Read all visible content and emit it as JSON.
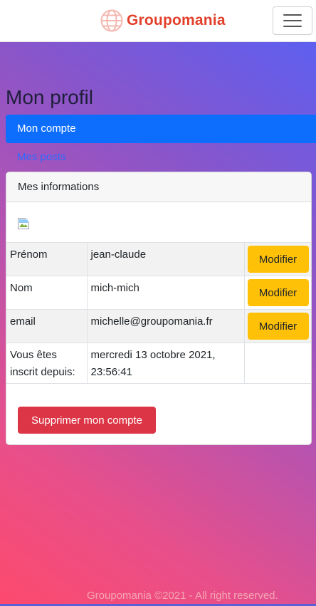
{
  "navbar": {
    "brand_name": "Groupomania",
    "brand_color": "#e2402b",
    "brand_icon": "globe-icon",
    "toggle_icon": "hamburger-icon"
  },
  "page": {
    "title": "Mon profil"
  },
  "tabs": {
    "active_label": "Mon compte",
    "posts_label": "Mes posts",
    "active_color": "#0d6efd"
  },
  "card": {
    "header": "Mes informations",
    "avatar_icon": "broken-image-icon",
    "rows": [
      {
        "label": "Prénom",
        "value": "jean-claude",
        "action": "Modifier"
      },
      {
        "label": "Nom",
        "value": "mich-mich",
        "action": "Modifier"
      },
      {
        "label": "email",
        "value": "michelle@groupomania.fr",
        "action": "Modifier"
      },
      {
        "label": "Vous êtes inscrit depuis:",
        "value": "mercredi 13 octobre 2021, 23:56:41"
      }
    ],
    "delete_label": "Supprimer mon compte",
    "modify_color": "#ffc107",
    "delete_color": "#dc3545"
  },
  "footer": {
    "text": "Groupomania ©2021 - All right reserved."
  }
}
